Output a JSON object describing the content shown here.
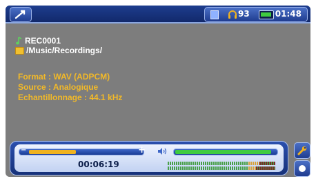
{
  "status": {
    "volume": "93",
    "time": "01:48"
  },
  "file": {
    "name": "REC0001",
    "path": "/Music/Recordings/"
  },
  "meta": {
    "format": "Format : WAV (ADPCM)",
    "source": "Source : Analogique",
    "sampling": "Echantillonnage : 44.1 kHz"
  },
  "player": {
    "elapsed": "00:06:19",
    "position_fraction": 0.45,
    "volume_fraction": 0.95,
    "level_left_fraction": 0.85,
    "level_right_fraction": 0.82
  },
  "colors": {
    "accent": "#f2b928",
    "volume": "#3fcb3f",
    "bar_blue": "#12296b"
  },
  "icons": [
    "back-icon",
    "hdd-icon",
    "headphones-icon",
    "battery-icon",
    "note-icon",
    "folder-icon",
    "speaker-icon",
    "wrench-icon",
    "record-icon"
  ]
}
